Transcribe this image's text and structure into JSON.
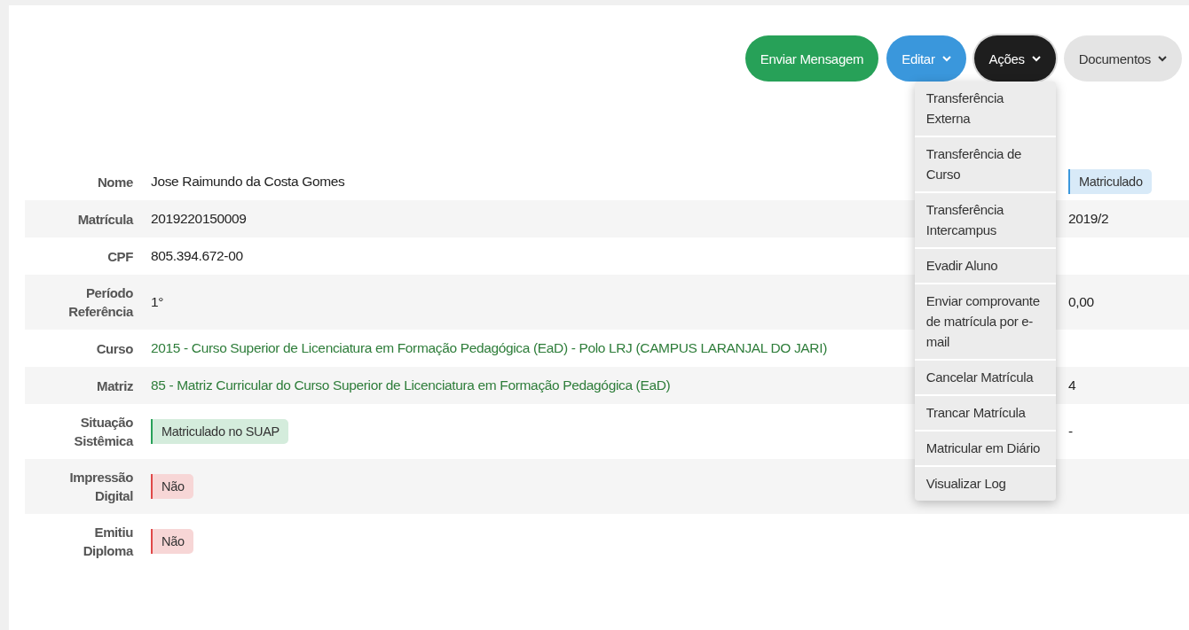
{
  "actions": [
    {
      "label": "Enviar Mensagem",
      "kind": "success",
      "dropdown": false,
      "expanded": false
    },
    {
      "label": "Editar",
      "kind": "info",
      "dropdown": true,
      "expanded": false
    },
    {
      "label": "Ações",
      "kind": "dark",
      "dropdown": true,
      "expanded": true
    },
    {
      "label": "Documentos",
      "kind": "default",
      "dropdown": true,
      "expanded": false
    }
  ],
  "actions_menu": [
    "Transferência Externa",
    "Transferência de Curso",
    "Transferência Intercampus",
    "Evadir Aluno",
    "Enviar comprovante de matrícula por e-mail",
    "Cancelar Matrícula",
    "Trancar Matrícula",
    "Matricular em Diário",
    "Visualizar Log"
  ],
  "details": [
    {
      "label": "Nome",
      "value": "Jose Raimundo da Costa Gomes",
      "kind": "text",
      "right": {
        "value": "Matriculado",
        "kind": "badge-info"
      }
    },
    {
      "label": "Matrícula",
      "value": "2019220150009",
      "kind": "text",
      "right": {
        "value": "2019/2",
        "kind": "text"
      }
    },
    {
      "label": "CPF",
      "value": "805.394.672-00",
      "kind": "text"
    },
    {
      "label": "Período Referência",
      "value": "1°",
      "kind": "text",
      "right": {
        "value": "0,00",
        "kind": "text"
      }
    },
    {
      "label": "Curso",
      "value": "2015 - Curso Superior de Licenciatura em Formação Pedagógica (EaD) - Polo LRJ (CAMPUS LARANJAL DO JARI)",
      "kind": "link"
    },
    {
      "label": "Matriz",
      "value": "85 - Matriz Curricular do Curso Superior de Licenciatura em Formação Pedagógica (EaD)",
      "kind": "link",
      "right": {
        "value": "4",
        "kind": "text"
      }
    },
    {
      "label": "Situação Sistêmica",
      "value": "Matriculado no SUAP",
      "kind": "badge-success",
      "right": {
        "value": "-",
        "kind": "text"
      }
    },
    {
      "label": "Impressão Digital",
      "value": "Não",
      "kind": "badge-danger"
    },
    {
      "label": "Emitiu Diploma",
      "value": "Não",
      "kind": "badge-danger"
    }
  ]
}
